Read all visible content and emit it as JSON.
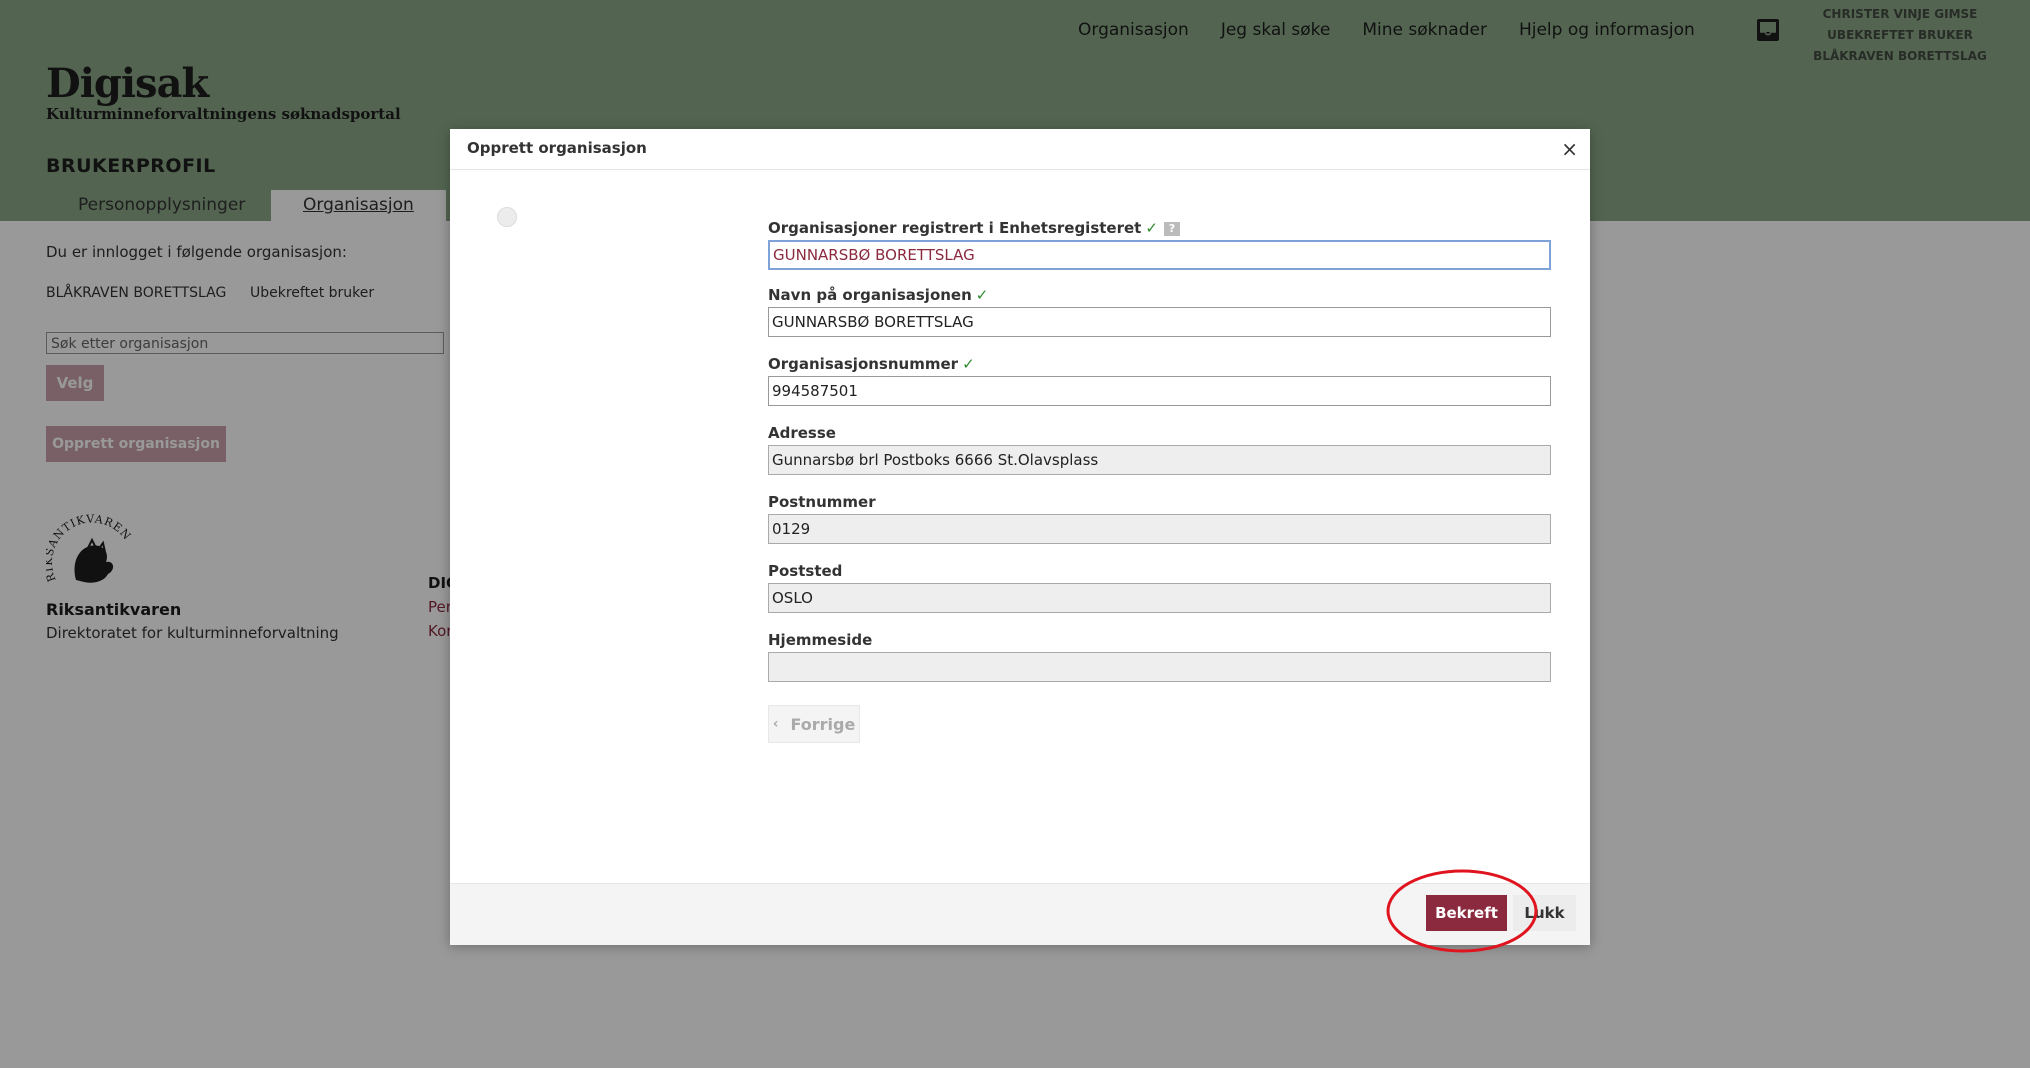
{
  "header": {
    "app_title": "Digisak",
    "app_subtitle": "Kulturminneforvaltningens søknadsportal",
    "nav": [
      "Organisasjon",
      "Jeg skal søke",
      "Mine søknader",
      "Hjelp og informasjon"
    ],
    "user": {
      "name": "CHRISTER VINJE GIMSE",
      "status": "UBEKREFTET BRUKER",
      "org": "BLÅKRAVEN BORETTSLAG"
    }
  },
  "profile": {
    "title": "BRUKERPROFIL",
    "tabs": [
      "Personopplysninger",
      "Organisasjon"
    ],
    "active_tab": "Organisasjon"
  },
  "content": {
    "logged_in_text": "Du er innlogget i følgende organisasjon:",
    "org_name": "BLÅKRAVEN BORETTSLAG",
    "org_status": "Ubekreftet bruker",
    "search_value": "Søk etter organisasjon",
    "velg_label": "Velg",
    "opprett_label": "Opprett organisasjon"
  },
  "footer": {
    "seal_text": "RIKSANTIKVAREN",
    "name": "Riksantikvaren",
    "directorate": "Direktoratet for kulturminneforvaltning",
    "col_heading": "DIG",
    "col_link1": "Per",
    "col_link2": "Kor"
  },
  "modal": {
    "title": "Opprett organisasjon",
    "close_symbol": "×",
    "fields": [
      {
        "label": "Organisasjoner registrert i Enhetsregisteret",
        "check": "✓",
        "help": "?",
        "value": "GUNNARSBØ BORETTSLAG"
      },
      {
        "label": "Navn på organisasjonen",
        "check": "✓",
        "value": "GUNNARSBØ BORETTSLAG"
      },
      {
        "label": "Organisasjonsnummer",
        "check": "✓",
        "value": "994587501"
      },
      {
        "label": "Adresse",
        "value": "Gunnarsbø brl Postboks 6666 St.Olavsplass"
      },
      {
        "label": "Postnummer",
        "value": "0129"
      },
      {
        "label": "Poststed",
        "value": "OSLO"
      },
      {
        "label": "Hjemmeside",
        "value": ""
      }
    ],
    "prev_button": "Forrige",
    "prev_chevron": "‹",
    "confirm_button": "Bekreft",
    "close_button": "Lukk"
  },
  "colors": {
    "header_bg": "#8ba888",
    "accent": "#8b2a3e",
    "check_green": "#2e8b2e",
    "highlight_ellipse": "#e0141e"
  }
}
